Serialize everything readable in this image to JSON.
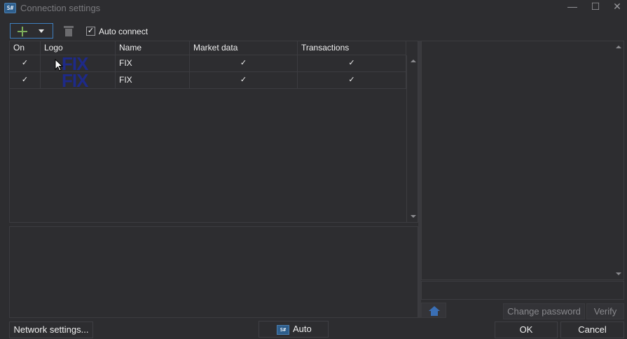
{
  "window": {
    "app_icon_text": "S#",
    "title": "Connection settings",
    "minimize": "—",
    "maximize": "☐",
    "close": "✕"
  },
  "toolbar": {
    "auto_connect_label": "Auto connect",
    "auto_connect_checked": "✓"
  },
  "grid": {
    "columns": [
      "On",
      "Logo",
      "Name",
      "Market data",
      "Transactions"
    ],
    "rows": [
      {
        "on": "✓",
        "logo": "FIX",
        "name": "FIX",
        "market_data": "✓",
        "transactions": "✓"
      },
      {
        "on": "✓",
        "logo": "FIX",
        "name": "FIX",
        "market_data": "✓",
        "transactions": "✓"
      }
    ]
  },
  "right_panel": {
    "change_password_label": "Change password",
    "verify_label": "Verify"
  },
  "footer": {
    "network_settings_label": "Network settings...",
    "auto_icon_text": "S#",
    "auto_label": "Auto",
    "ok_label": "OK",
    "cancel_label": "Cancel"
  },
  "colors": {
    "background": "#2d2d30",
    "accent_border": "#3f7fbf",
    "add_icon": "#7cae5a",
    "fix_logo": "#1e2a88",
    "home_icon": "#3a6fb5"
  }
}
